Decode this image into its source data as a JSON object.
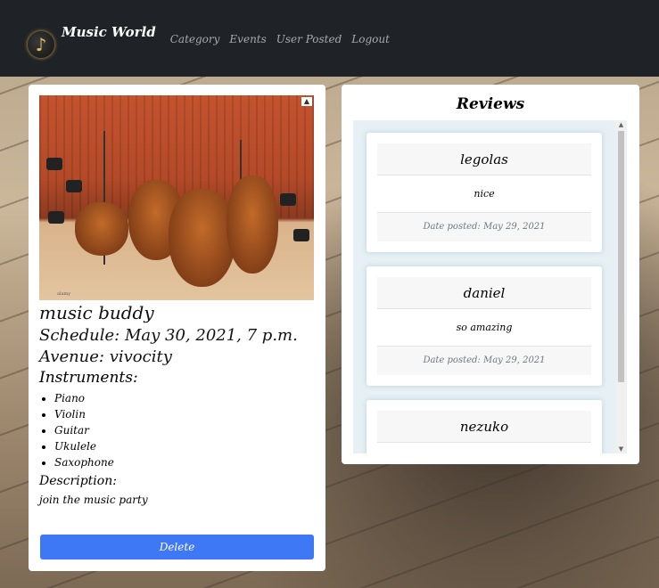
{
  "nav": {
    "brand": "Music World",
    "links": [
      "Category",
      "Events",
      "User Posted",
      "Logout"
    ]
  },
  "event": {
    "title": "music buddy",
    "schedule": "Schedule: May 30, 2021, 7 p.m.",
    "venue": "Avenue: vivocity",
    "instruments_label": "Instruments:",
    "instruments": [
      "Piano",
      "Violin",
      "Guitar",
      "Ukulele",
      "Saxophone"
    ],
    "description_label": "Description:",
    "description": "join the music party",
    "delete_label": "Delete"
  },
  "reviews": {
    "title": "Reviews",
    "items": [
      {
        "name": "legolas",
        "text": "nice",
        "date": "Date posted: May 29, 2021"
      },
      {
        "name": "daniel",
        "text": "so amazing",
        "date": "Date posted: May 29, 2021"
      },
      {
        "name": "nezuko",
        "text": "",
        "date": ""
      }
    ]
  },
  "colors": {
    "navbar": "#1f2226",
    "delete_button": "#3f78f5",
    "reviews_bg": "#e7f0f4"
  }
}
